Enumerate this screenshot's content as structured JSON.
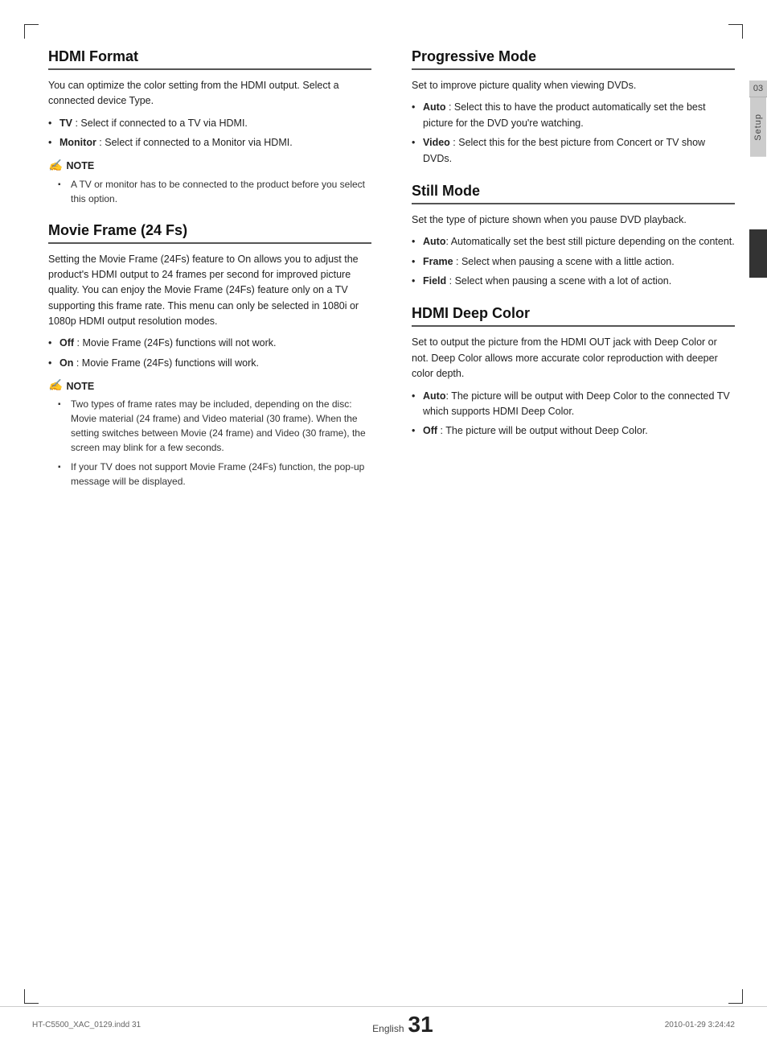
{
  "page": {
    "corners": true,
    "footer": {
      "left_text": "HT-C5500_XAC_0129.indd   31",
      "right_text": "2010-01-29   3:24:42",
      "page_label": "English",
      "page_number": "31"
    },
    "side_tab": {
      "number": "03",
      "label": "Setup"
    }
  },
  "left_column": {
    "sections": [
      {
        "id": "hdmi-format",
        "title": "HDMI Format",
        "intro": "You can optimize the color setting from the HDMI output. Select a connected device Type.",
        "bullets": [
          {
            "bold": "TV",
            "text": ": Select if connected to a TV via HDMI."
          },
          {
            "bold": "Monitor",
            "text": ": Select if connected to a Monitor via HDMI."
          }
        ],
        "note": {
          "title": "NOTE",
          "items": [
            "A TV or monitor has to be connected to the product before you select this option."
          ]
        }
      },
      {
        "id": "movie-frame",
        "title": "Movie Frame (24 Fs)",
        "intro": "Setting the Movie Frame (24Fs) feature to On allows you to adjust the product's HDMI output to 24 frames per second for improved picture quality. You can enjoy the Movie Frame (24Fs) feature only on a TV supporting this frame rate. This menu can only be selected in 1080i or 1080p HDMI output resolution modes.",
        "bullets": [
          {
            "bold": "Off",
            "text": " : Movie Frame (24Fs) functions will not work."
          },
          {
            "bold": "On",
            "text": "  : Movie Frame (24Fs) functions will work."
          }
        ],
        "note": {
          "title": "NOTE",
          "items": [
            "Two types of frame rates may be included, depending on the disc: Movie material (24 frame) and Video material (30 frame). When the setting switches between Movie (24 frame) and Video (30 frame), the screen may blink for a few seconds.",
            "If your TV does not support Movie Frame (24Fs) function, the pop-up message will be displayed."
          ]
        }
      }
    ]
  },
  "right_column": {
    "sections": [
      {
        "id": "progressive-mode",
        "title": "Progressive Mode",
        "intro": "Set to improve picture quality when viewing DVDs.",
        "bullets": [
          {
            "bold": "Auto",
            "text": ": Select this to have the product automatically set the best picture for the DVD you're watching."
          },
          {
            "bold": "Video",
            "text": ": Select this for the best picture from Concert or TV show DVDs."
          }
        ]
      },
      {
        "id": "still-mode",
        "title": "Still Mode",
        "intro": "Set the type of picture shown when you pause DVD playback.",
        "bullets": [
          {
            "bold": "Auto",
            "text": ": Automatically set the best still picture depending on the content."
          },
          {
            "bold": "Frame",
            "text": " : Select when pausing a scene with a little action."
          },
          {
            "bold": "Field",
            "text": " : Select when pausing a scene with a lot of action."
          }
        ]
      },
      {
        "id": "hdmi-deep-color",
        "title": "HDMI Deep Color",
        "intro": "Set to output the picture from the HDMI OUT jack with Deep Color or not. Deep Color allows more accurate color reproduction with deeper color depth.",
        "bullets": [
          {
            "bold": "Auto",
            "text": ": The picture will be output with Deep Color to the connected TV which supports HDMI Deep Color."
          },
          {
            "bold": "Off",
            "text": " : The picture will be output without Deep Color."
          }
        ]
      }
    ]
  }
}
